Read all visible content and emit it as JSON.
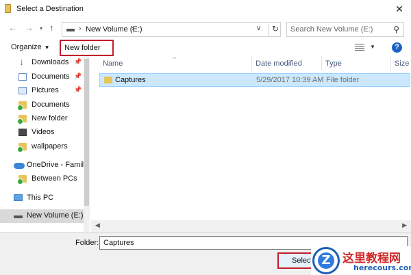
{
  "window": {
    "title": "Select a Destination"
  },
  "address": {
    "path_item": "New Volume (E:)",
    "search_placeholder": "Search New Volume (E:)"
  },
  "toolbar": {
    "organize_label": "Organize",
    "new_folder_label": "New folder",
    "help_label": "?"
  },
  "sidebar": {
    "items": [
      {
        "label": "Downloads",
        "icon": "download-icon",
        "pinned": true
      },
      {
        "label": "Documents",
        "icon": "documents-icon",
        "pinned": true
      },
      {
        "label": "Pictures",
        "icon": "pictures-icon",
        "pinned": true
      },
      {
        "label": "Documents",
        "icon": "folder-icon"
      },
      {
        "label": "New folder",
        "icon": "folder-icon"
      },
      {
        "label": "Videos",
        "icon": "videos-icon"
      },
      {
        "label": "wallpapers",
        "icon": "folder-icon"
      },
      {
        "label": "OneDrive - Family",
        "icon": "onedrive-icon"
      },
      {
        "label": "Between PCs",
        "icon": "folder-icon"
      },
      {
        "label": "This PC",
        "icon": "computer-icon"
      },
      {
        "label": "New Volume (E:)",
        "icon": "drive-icon",
        "selected": true
      }
    ]
  },
  "columns": [
    "Name",
    "Date modified",
    "Type",
    "Size"
  ],
  "files": [
    {
      "name": "Captures",
      "date_modified": "5/29/2017 10:39 AM",
      "type": "File folder",
      "size": ""
    }
  ],
  "footer": {
    "folder_label": "Folder:",
    "folder_value": "Captures",
    "select_label": "Select"
  },
  "watermark": {
    "chinese_text": "这里教程网",
    "url": "herecours.com",
    "badge_letter": "Z"
  },
  "colors": {
    "highlight_red": "#c11d2b",
    "selection_blue": "#cce8ff",
    "folder_yellow": "#e8c45c",
    "help_blue": "#1a63c6"
  }
}
